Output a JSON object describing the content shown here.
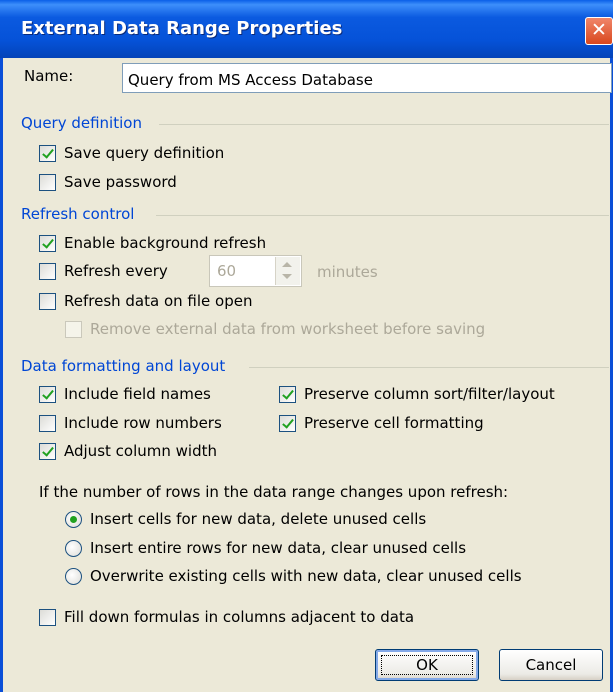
{
  "window": {
    "title": "External Data Range Properties",
    "close_glyph": "✕"
  },
  "name": {
    "label": "Name:",
    "value": "Query from MS Access Database"
  },
  "query_definition": {
    "header": "Query definition",
    "save_query": {
      "label": "Save query definition",
      "checked": true
    },
    "save_password": {
      "label": "Save password",
      "checked": false
    }
  },
  "refresh_control": {
    "header": "Refresh control",
    "enable_background": {
      "label": "Enable background refresh",
      "checked": true
    },
    "refresh_every": {
      "label": "Refresh every",
      "checked": false,
      "value": "60",
      "unit": "minutes"
    },
    "refresh_on_open": {
      "label": "Refresh data on file open",
      "checked": false
    },
    "remove_external": {
      "label": "Remove external data from worksheet before saving",
      "checked": false,
      "enabled": false
    }
  },
  "formatting": {
    "header": "Data formatting and layout",
    "include_field_names": {
      "label": "Include field names",
      "checked": true
    },
    "include_row_numbers": {
      "label": "Include row numbers",
      "checked": false
    },
    "adjust_column_width": {
      "label": "Adjust column width",
      "checked": true
    },
    "preserve_sort": {
      "label": "Preserve column sort/filter/layout",
      "checked": true
    },
    "preserve_cell_formatting": {
      "label": "Preserve cell formatting",
      "checked": true
    },
    "rows_change_prompt": "If the number of rows in the data range changes upon refresh:",
    "options": [
      {
        "label": "Insert cells for new data, delete unused cells",
        "selected": true
      },
      {
        "label": "Insert entire rows for new data, clear unused cells",
        "selected": false
      },
      {
        "label": "Overwrite existing cells with new data, clear unused cells",
        "selected": false
      }
    ],
    "fill_down": {
      "label": "Fill down formulas in columns adjacent to data",
      "checked": false
    }
  },
  "buttons": {
    "ok": "OK",
    "cancel": "Cancel"
  },
  "colors": {
    "title_bar": "#0552d8",
    "group_header": "#0046d5",
    "check_mark": "#21a121",
    "dialog_bg": "#ece9d8"
  }
}
